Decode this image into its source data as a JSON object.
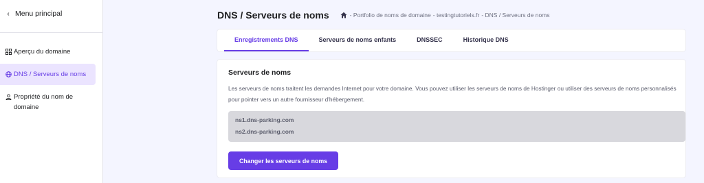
{
  "sidebar": {
    "back_label": "Menu principal",
    "items": [
      {
        "label": "Aperçu du domaine",
        "icon": "grid-icon"
      },
      {
        "label": "DNS / Serveurs de noms",
        "icon": "globe-icon",
        "active": true
      },
      {
        "label": "Propriété du nom de domaine",
        "icon": "user-icon"
      }
    ]
  },
  "header": {
    "title": "DNS / Serveurs de noms",
    "breadcrumb": [
      "- Portfolio de noms de domaine",
      "- testingtutoriels.fr",
      "- DNS / Serveurs de noms"
    ]
  },
  "tabs": [
    {
      "label": "Enregistrements DNS",
      "active": true
    },
    {
      "label": "Serveurs de noms enfants"
    },
    {
      "label": "DNSSEC"
    },
    {
      "label": "Historique DNS"
    }
  ],
  "nameservers_section": {
    "title": "Serveurs de noms",
    "description": "Les serveurs de noms traitent les demandes Internet pour votre domaine. Vous pouvez utiliser les serveurs de noms de Hostinger ou utiliser des serveurs de noms personnalisés pour pointer vers un autre fournisseur d'hébergement.",
    "servers": [
      "ns1.dns-parking.com",
      "ns2.dns-parking.com"
    ],
    "button_label": "Changer les serveurs de noms"
  },
  "colors": {
    "accent": "#673de6",
    "active_bg": "#ebe4ff",
    "page_bg": "#f4f5ff"
  }
}
